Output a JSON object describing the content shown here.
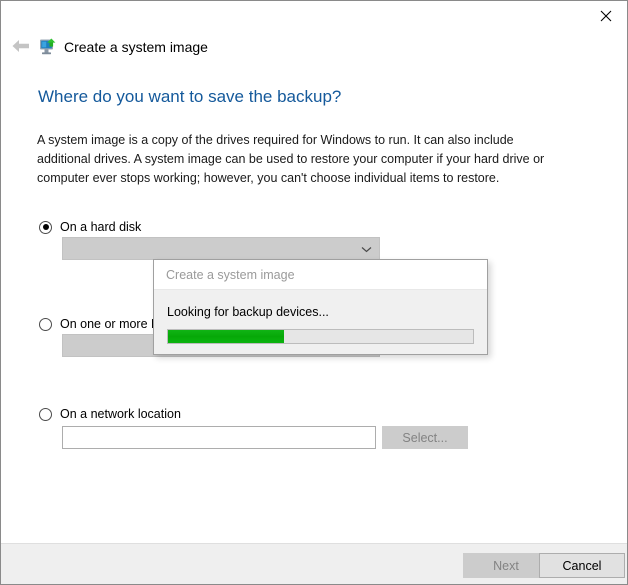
{
  "window": {
    "close_icon": "close-icon",
    "back_icon": "back-arrow-icon",
    "app_icon": "system-image-icon",
    "app_title": "Create a system image"
  },
  "page": {
    "heading": "Where do you want to save the backup?",
    "description": "A system image is a copy of the drives required for Windows to run. It can also include additional drives. A system image can be used to restore your computer if your hard drive or computer ever stops working; however, you can't choose individual items to restore."
  },
  "options": [
    {
      "id": "hard-disk",
      "label": "On a hard disk",
      "selected": true,
      "control": "combobox",
      "value": "",
      "chevron_icon": "chevron-down-icon"
    },
    {
      "id": "dvd",
      "label": "On one or more D",
      "selected": false,
      "control": "combobox",
      "value": "",
      "chevron_icon": "chevron-down-icon"
    },
    {
      "id": "network-location",
      "label": "On a network location",
      "selected": false,
      "control": "textbox",
      "value": "",
      "button_label": "Select...",
      "button_enabled": false
    }
  ],
  "footer": {
    "next_label": "Next",
    "next_enabled": false,
    "cancel_label": "Cancel",
    "cancel_enabled": true
  },
  "progress_dialog": {
    "title": "Create a system image",
    "message": "Looking for backup devices...",
    "progress_percent": 38,
    "progress_color": "#09ab0b",
    "track_color": "#e6e6e6"
  },
  "colors": {
    "heading": "#14599b",
    "footer_bg": "#efefef",
    "window_border": "#8a8a8a"
  }
}
